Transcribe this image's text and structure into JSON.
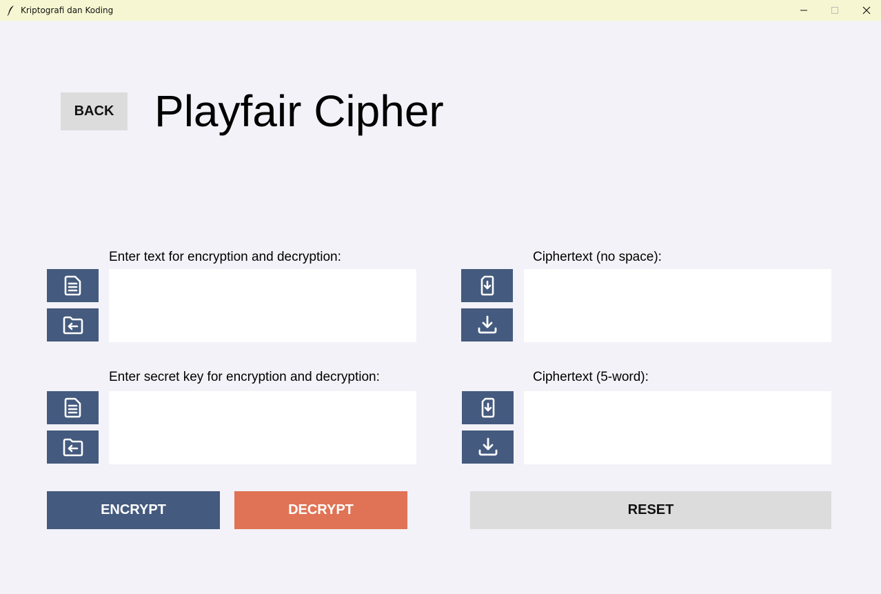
{
  "window": {
    "title": "Kriptografi dan Koding"
  },
  "header": {
    "back_label": "BACK",
    "page_title": "Playfair Cipher"
  },
  "input": {
    "text_label": "Enter text for encryption and decryption:",
    "text_value": "",
    "key_label": "Enter secret key for encryption and decryption:",
    "key_value": ""
  },
  "output": {
    "nospace_label": "Ciphertext (no space):",
    "nospace_value": "",
    "fiveword_label": "Ciphertext (5-word):",
    "fiveword_value": ""
  },
  "actions": {
    "encrypt_label": "ENCRYPT",
    "decrypt_label": "DECRYPT",
    "reset_label": "RESET"
  },
  "colors": {
    "titlebar": "#f6f6d2",
    "background": "#f3f2f8",
    "primary": "#445a7e",
    "accent": "#e07356",
    "neutral": "#dcdcdc"
  },
  "icons": {
    "text_file": "document-icon",
    "folder_open": "folder-open-icon",
    "file_download": "file-download-icon",
    "download": "download-icon"
  }
}
